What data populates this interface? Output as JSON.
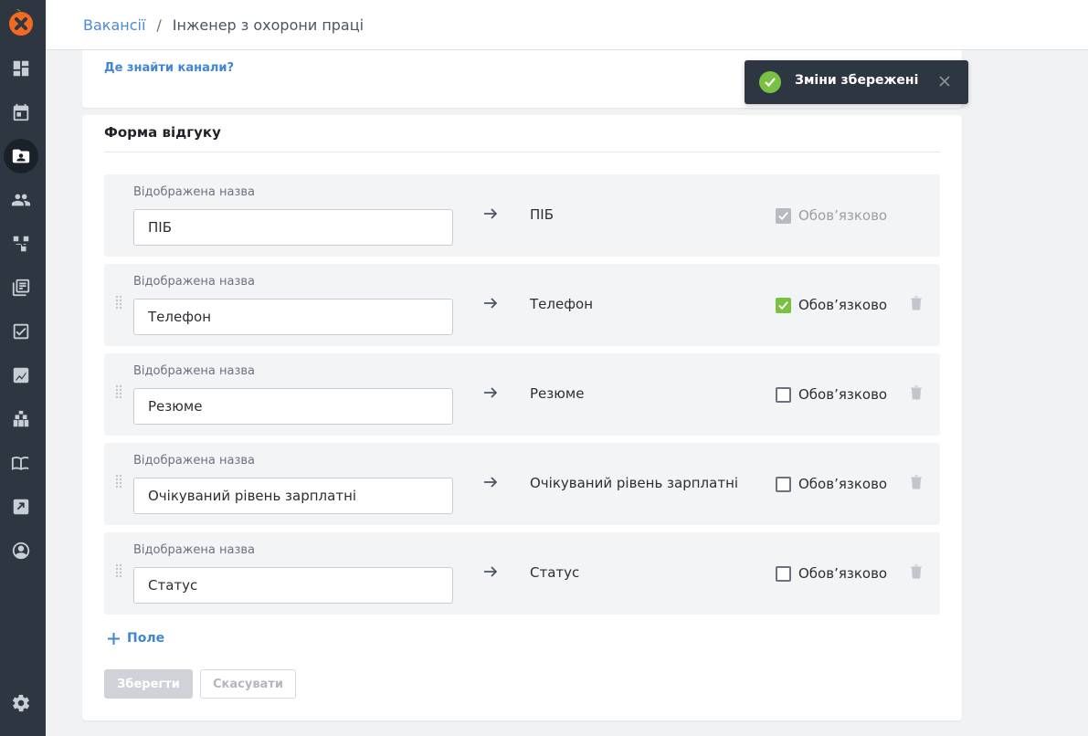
{
  "breadcrumb": {
    "parent": "Вакансії",
    "separator": "/",
    "current": "Інженер з охорони праці"
  },
  "top_card": {
    "channels_link": "Де знайти канали?"
  },
  "form": {
    "title": "Форма відгуку",
    "field_label": "Відображена назва",
    "required_label": "Обов’язково",
    "fields": [
      {
        "display_name": "ПІБ",
        "target": "ПІБ",
        "required": true,
        "locked": true
      },
      {
        "display_name": "Телефон",
        "target": "Телефон",
        "required": true,
        "locked": false
      },
      {
        "display_name": "Резюме",
        "target": "Резюме",
        "required": false,
        "locked": false
      },
      {
        "display_name": "Очікуваний рівень зарплатні",
        "target": "Очікуваний рівень зарплатні",
        "required": false,
        "locked": false
      },
      {
        "display_name": "Статус",
        "target": "Статус",
        "required": false,
        "locked": false
      }
    ],
    "add_field_label": "Поле",
    "save_label": "Зберегти",
    "cancel_label": "Скасувати"
  },
  "toast": {
    "message": "Зміни збережені"
  },
  "sidebar": {
    "items": [
      "dashboard-icon",
      "calendar-icon",
      "candidates-icon",
      "team-icon",
      "pipeline-icon",
      "library-icon",
      "tasks-icon",
      "analytics-icon",
      "integrations-icon",
      "knowledge-base-icon",
      "export-icon",
      "profile-icon",
      "settings-icon"
    ],
    "active": "candidates-icon"
  },
  "colors": {
    "sidebar_bg": "#2d3641",
    "accent_link": "#3f86d4",
    "check_green": "#7ac143"
  }
}
